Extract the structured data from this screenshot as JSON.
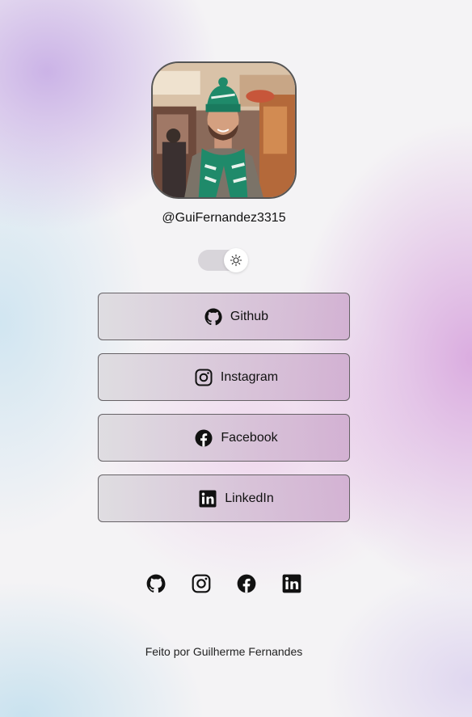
{
  "profile": {
    "handle": "@GuiFernandez3315",
    "avatar_alt": "profile photo"
  },
  "theme_toggle": {
    "state": "light",
    "icon": "sun-icon"
  },
  "links": [
    {
      "label": "Github",
      "icon": "github-icon"
    },
    {
      "label": "Instagram",
      "icon": "instagram-icon"
    },
    {
      "label": "Facebook",
      "icon": "facebook-icon"
    },
    {
      "label": "LinkedIn",
      "icon": "linkedin-icon"
    }
  ],
  "social_icons": [
    "github-icon",
    "instagram-icon",
    "facebook-icon",
    "linkedin-icon"
  ],
  "footer": {
    "text": "Feito por Guilherme Fernandes"
  },
  "colors": {
    "button_border": "#666266",
    "text": "#111111",
    "accent_green": "#1f8a6a"
  }
}
